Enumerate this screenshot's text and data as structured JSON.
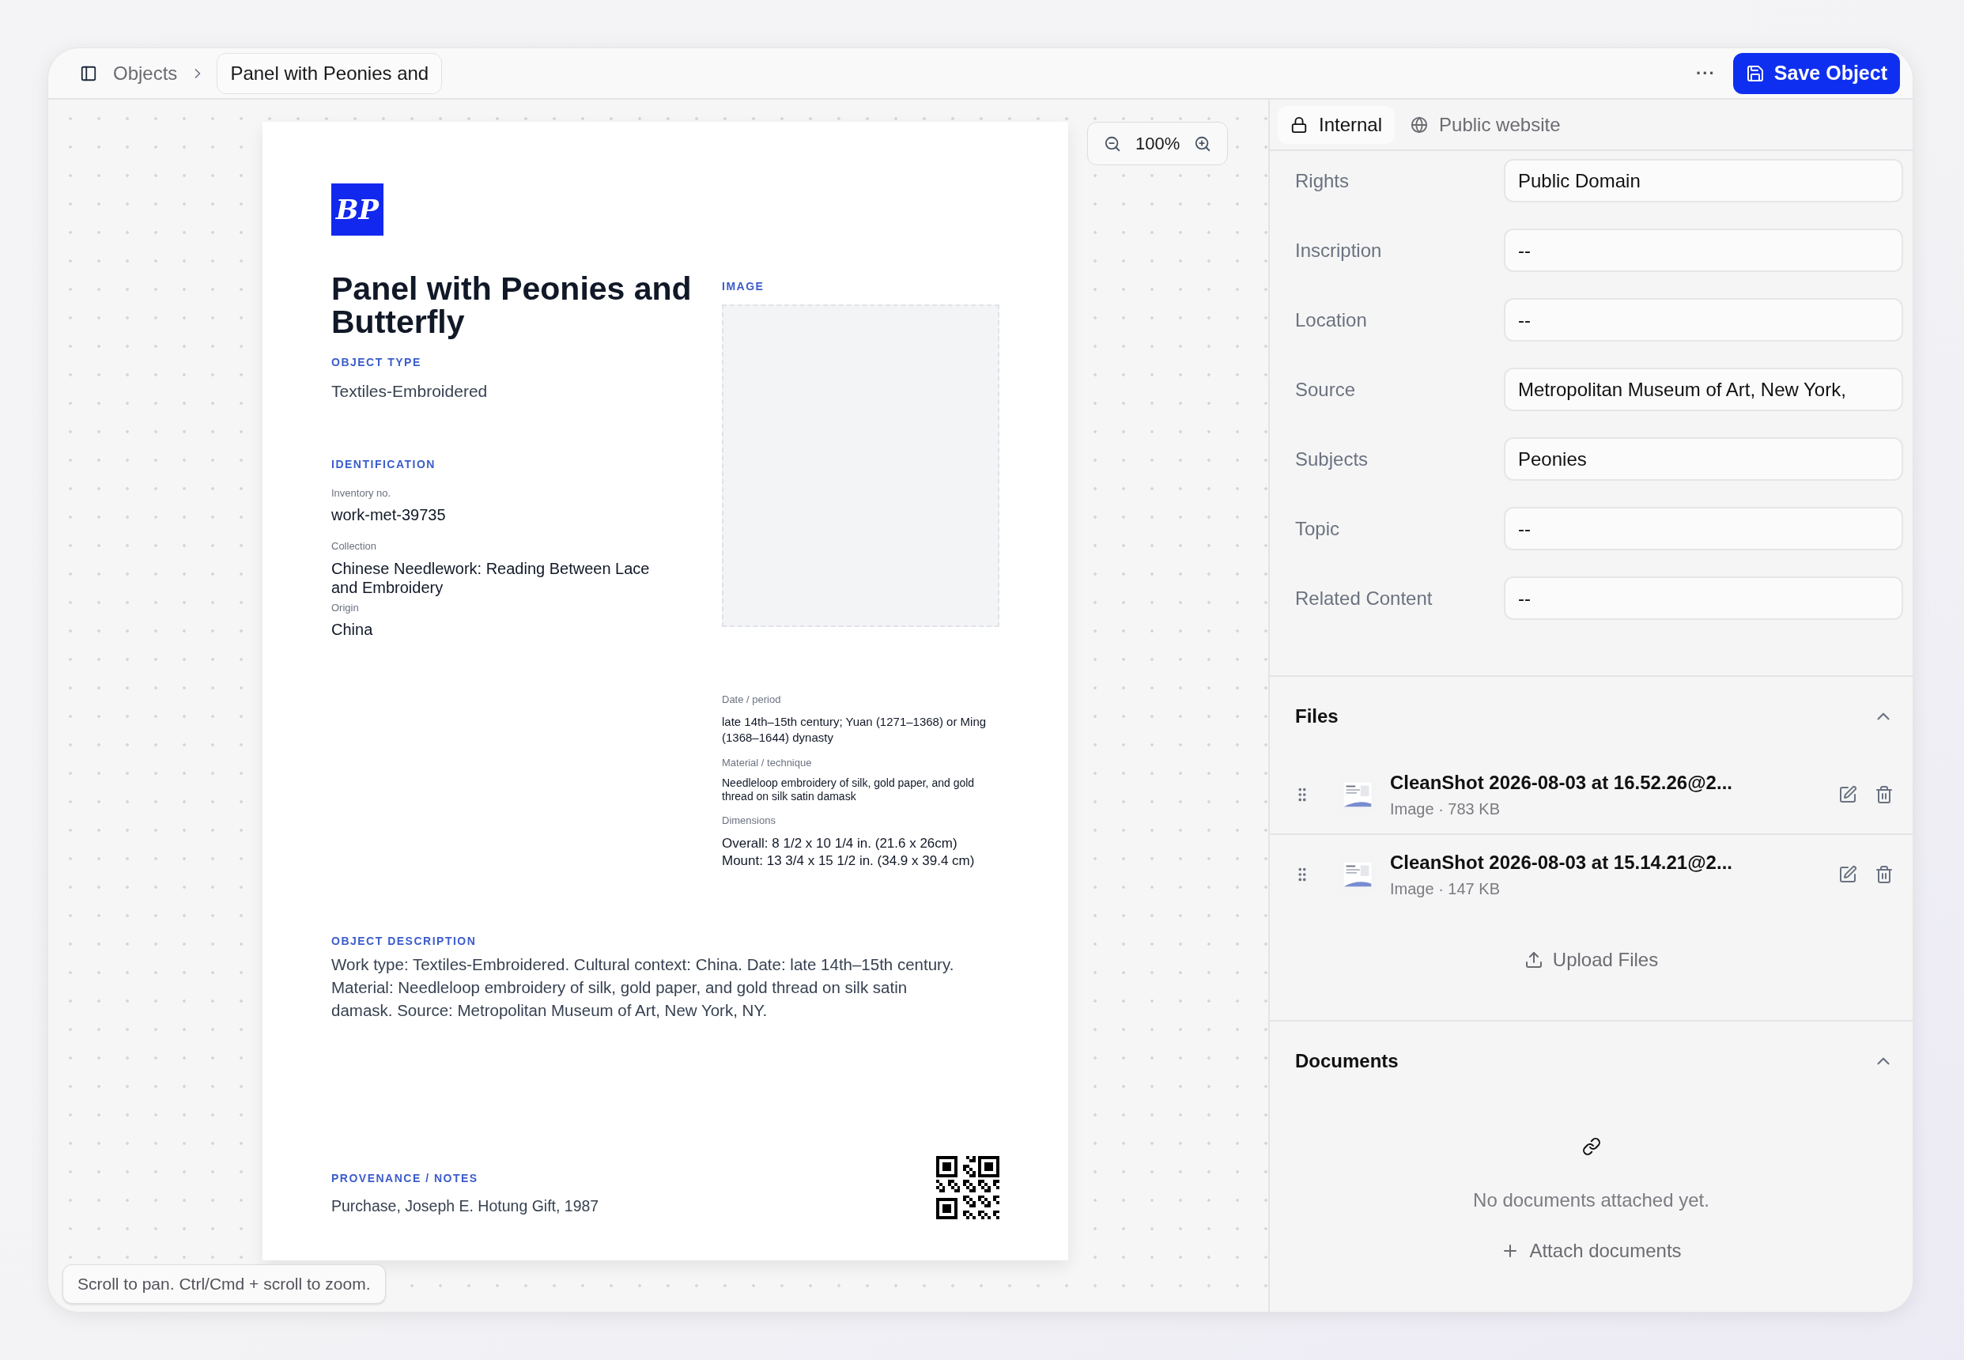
{
  "header": {
    "breadcrumb": "Objects",
    "current": "Panel with Peonies and",
    "more": "···",
    "save_button": "Save Object"
  },
  "zoom": {
    "value": "100%"
  },
  "document": {
    "logo_text": "BP",
    "title": "Panel with Peonies and Butterfly",
    "object_type_label": "OBJECT TYPE",
    "object_type": "Textiles-Embroidered",
    "identification_label": "IDENTIFICATION",
    "identification": [
      {
        "label": "Inventory no.",
        "value": "work-met-39735"
      },
      {
        "label": "Collection",
        "value": "Chinese Needlework: Reading Between Lace and Embroidery"
      },
      {
        "label": "Origin",
        "value": "China"
      }
    ],
    "image_label": "IMAGE",
    "details": [
      {
        "label": "Date / period",
        "value": "late 14th–15th century; Yuan (1271–1368) or Ming (1368–1644) dynasty",
        "kind": "medium"
      },
      {
        "label": "Material / technique",
        "value": "Needleloop embroidery of silk, gold paper, and gold thread on silk satin damask",
        "kind": "small"
      },
      {
        "label": "Dimensions",
        "value": "Overall: 8 1/2 x 10 1/4 in. (21.6 x 26cm)\nMount: 13 3/4 x 15 1/2 in. (34.9 x 39.4 cm)",
        "kind": "large"
      }
    ],
    "description_label": "OBJECT DESCRIPTION",
    "description": "Work type: Textiles-Embroidered. Cultural context: China. Date: late 14th–15th century. Material: Needleloop embroidery of silk, gold paper, and gold thread on silk satin damask. Source: Metropolitan Museum of Art, New York, NY.",
    "provenance_label": "PROVENANCE / NOTES",
    "provenance": "Purchase, Joseph E. Hotung Gift, 1987"
  },
  "hint": "Scroll to pan. Ctrl/Cmd + scroll to zoom.",
  "panel": {
    "tabs": [
      {
        "label": "Internal",
        "kind": "lock",
        "selected": true
      },
      {
        "label": "Public website",
        "kind": "globe",
        "selected": false
      }
    ],
    "fields": [
      {
        "label": "Rights",
        "value": "Public Domain"
      },
      {
        "label": "Inscription",
        "value": "--"
      },
      {
        "label": "Location",
        "value": "--"
      },
      {
        "label": "Source",
        "value": "Metropolitan Museum of Art, New York,"
      },
      {
        "label": "Subjects",
        "value": "Peonies"
      },
      {
        "label": "Topic",
        "value": "--"
      },
      {
        "label": "Related Content",
        "value": "--"
      }
    ],
    "files": {
      "title": "Files",
      "expanded": true,
      "items": [
        {
          "name": "CleanShot 2026-08-03 at 16.52.26@2...",
          "meta": "Image · 783 KB"
        },
        {
          "name": "CleanShot 2026-08-03 at 15.14.21@2...",
          "meta": "Image · 147 KB"
        }
      ],
      "upload": "Upload Files"
    },
    "documents": {
      "title": "Documents",
      "expanded": true,
      "empty": "No documents attached yet.",
      "attach": "Attach documents"
    }
  }
}
